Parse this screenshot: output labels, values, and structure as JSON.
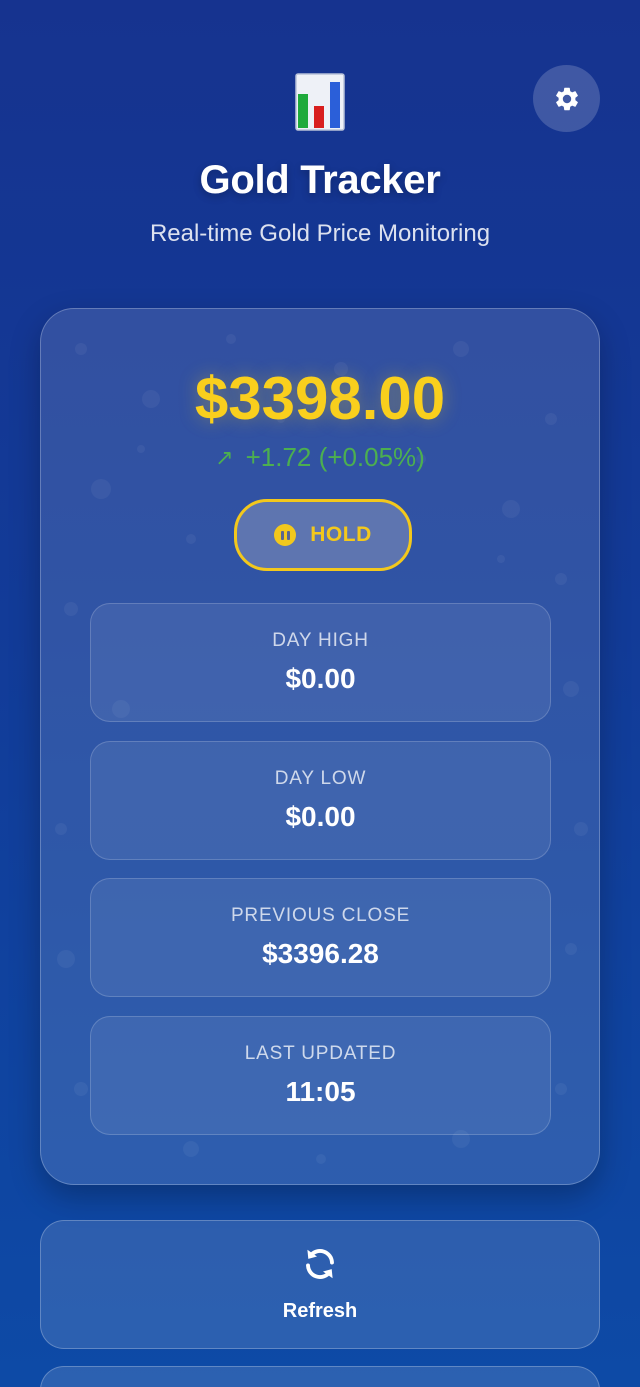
{
  "header": {
    "logo_icon": "bar-chart-icon",
    "title": "Gold Tracker",
    "subtitle": "Real-time Gold Price Monitoring",
    "settings_icon": "gear-icon"
  },
  "price_card": {
    "price": "$3398.00",
    "change_icon": "trend-up-arrow-icon",
    "change": "+1.72 (+0.05%)",
    "signal_icon": "pause-circle-icon",
    "signal": "HOLD",
    "stats": [
      {
        "label": "DAY HIGH",
        "value": "$0.00"
      },
      {
        "label": "DAY LOW",
        "value": "$0.00"
      },
      {
        "label": "PREVIOUS CLOSE",
        "value": "$3396.28"
      },
      {
        "label": "LAST UPDATED",
        "value": "11:05"
      }
    ]
  },
  "actions": {
    "refresh_icon": "refresh-icon",
    "refresh_label": "Refresh"
  },
  "colors": {
    "background_top": "#16338f",
    "background_bottom": "#0d4aa6",
    "price_gold": "#f9cf1d",
    "positive_green": "#4caf50",
    "signal_yellow": "#f3c81c"
  }
}
